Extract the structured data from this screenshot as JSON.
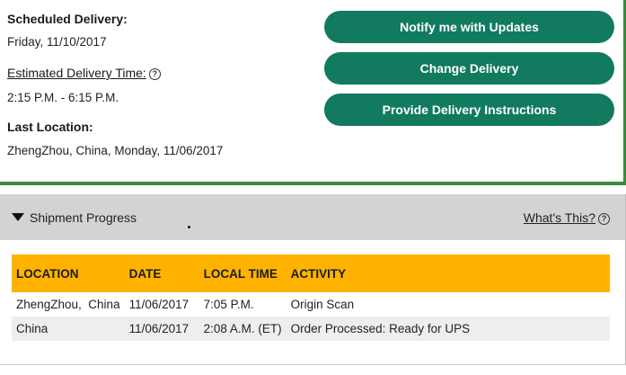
{
  "delivery": {
    "scheduled_label": "Scheduled Delivery:",
    "scheduled_value": "Friday, 11/10/2017",
    "estimated_label": "Estimated Delivery Time:",
    "estimated_value": "2:15 P.M. - 6:15 P.M.",
    "last_location_label": "Last Location:",
    "last_location_value": "ZhengZhou, China, Monday, 11/06/2017"
  },
  "actions": {
    "notify": "Notify me with Updates",
    "change": "Change Delivery",
    "instructions": "Provide Delivery Instructions"
  },
  "progress": {
    "toggle_label": "Shipment Progress",
    "whats_this": "What's This?",
    "columns": [
      "LOCATION",
      "DATE",
      "LOCAL TIME",
      "ACTIVITY"
    ],
    "rows": [
      [
        "ZhengZhou,  China",
        "11/06/2017",
        "7:05 P.M.",
        "Origin Scan"
      ],
      [
        "China",
        "11/06/2017",
        "2:08 A.M. (ET)",
        "Order Processed: Ready for UPS"
      ]
    ]
  },
  "colors": {
    "button": "#117a5f",
    "border_green": "#3b8b3b",
    "header_gray": "#d3d3d3",
    "table_header": "#ffb300"
  },
  "icons": {
    "help": "question-circle-icon",
    "toggle": "triangle-down-icon"
  }
}
